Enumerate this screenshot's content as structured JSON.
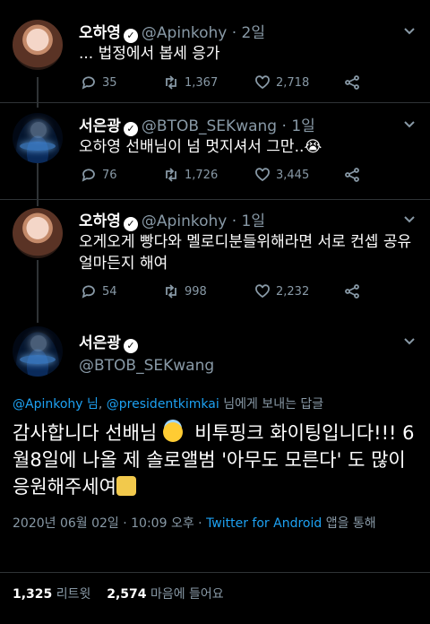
{
  "tweets": [
    {
      "name": "오하영",
      "handle": "@Apinkohy",
      "sep": "·",
      "time": "2일",
      "text": "... 법정에서 봅세 응가",
      "replies": "35",
      "retweets": "1,367",
      "likes": "2,718"
    },
    {
      "name": "서은광",
      "handle": "@BTOB_SEKwang",
      "sep": "·",
      "time": "1일",
      "text": "오하영 선배님이 넘 멋지셔서 그만..😭",
      "replies": "76",
      "retweets": "1,726",
      "likes": "3,445"
    },
    {
      "name": "오하영",
      "handle": "@Apinkohy",
      "sep": "·",
      "time": "1일",
      "text": "오게오게 빵다와 멜로디분들위해라면 서로 컨셉 공유 얼마든지 해여",
      "replies": "54",
      "retweets": "998",
      "likes": "2,232"
    }
  ],
  "main": {
    "name": "서은광",
    "handle": "@BTOB_SEKwang",
    "reply_link_1": "@Apinkohy 님",
    "reply_comma": ",",
    "reply_link_2": "@presidentkimkai",
    "reply_suffix": "님에게 보내는 답글",
    "text_1": "감사합니다 선배님",
    "text_2": "비투핑크 화이팅입니다!!! 6월8일에 나올 제 솔로앨범 '아무도 모른다' 도 많이 응원해주세여",
    "date": "2020년 06월 02일 · 10:09 오후 · ",
    "client": "Twitter for Android",
    "client_suffix": " 앱을 통해",
    "retweet_count": "1,325",
    "retweet_label": "리트윗",
    "like_count": "2,574",
    "like_label": "마음에 들어요"
  },
  "icons": {
    "reply": "comment-icon",
    "retweet": "retweet-icon",
    "like": "heart-icon",
    "share": "share-icon",
    "verified": "verified-badge-icon"
  },
  "colors": {
    "background": "#000000",
    "muted": "#8899a6",
    "link": "#1da1f2",
    "divider": "#2f3336"
  }
}
